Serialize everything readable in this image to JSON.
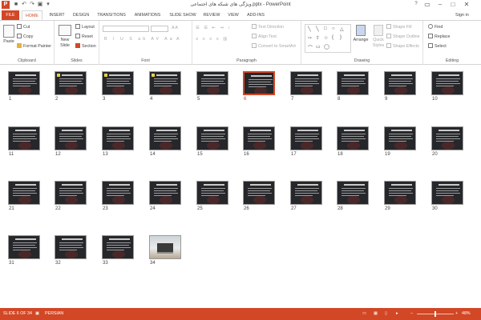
{
  "window": {
    "title": "ویژگی های شبکه های اجتماعی.pptx - PowerPoint",
    "app_icon": "P",
    "help": "?",
    "sign_in": "Sign in"
  },
  "tabs": [
    "FILE",
    "HOME",
    "INSERT",
    "DESIGN",
    "TRANSITIONS",
    "ANIMATIONS",
    "SLIDE SHOW",
    "REVIEW",
    "VIEW",
    "ADD-INS"
  ],
  "active_tab": "HOME",
  "ribbon": {
    "clipboard": {
      "label": "Clipboard",
      "paste": "Paste",
      "cut": "Cut",
      "copy": "Copy",
      "format_painter": "Format Painter"
    },
    "slides": {
      "label": "Slides",
      "new_slide": "New Slide",
      "layout": "Layout",
      "reset": "Reset",
      "section": "Section"
    },
    "font": {
      "label": "Font"
    },
    "paragraph": {
      "label": "Paragraph",
      "text_direction": "Text Direction",
      "align_text": "Align Text",
      "convert_smartart": "Convert to SmartArt"
    },
    "drawing": {
      "label": "Drawing",
      "arrange": "Arrange",
      "quick_styles": "Quick Styles",
      "shape_fill": "Shape Fill",
      "shape_outline": "Shape Outline",
      "shape_effects": "Shape Effects"
    },
    "editing": {
      "label": "Editing",
      "find": "Find",
      "replace": "Replace",
      "select": "Select"
    }
  },
  "slides": {
    "count": 34,
    "selected": 6,
    "numbers": [
      "1",
      "2",
      "3",
      "4",
      "5",
      "6",
      "7",
      "8",
      "9",
      "10",
      "11",
      "12",
      "13",
      "14",
      "15",
      "16",
      "17",
      "18",
      "19",
      "20",
      "21",
      "22",
      "23",
      "24",
      "25",
      "26",
      "27",
      "28",
      "29",
      "30",
      "31",
      "32",
      "33",
      "34"
    ]
  },
  "status": {
    "slide_position": "SLIDE 6 OF 34",
    "language": "PERSIAN",
    "zoom": "48%",
    "zoom_level": 0.48
  },
  "colors": {
    "accent": "#d24726",
    "thumb_bg": "#26272b"
  }
}
